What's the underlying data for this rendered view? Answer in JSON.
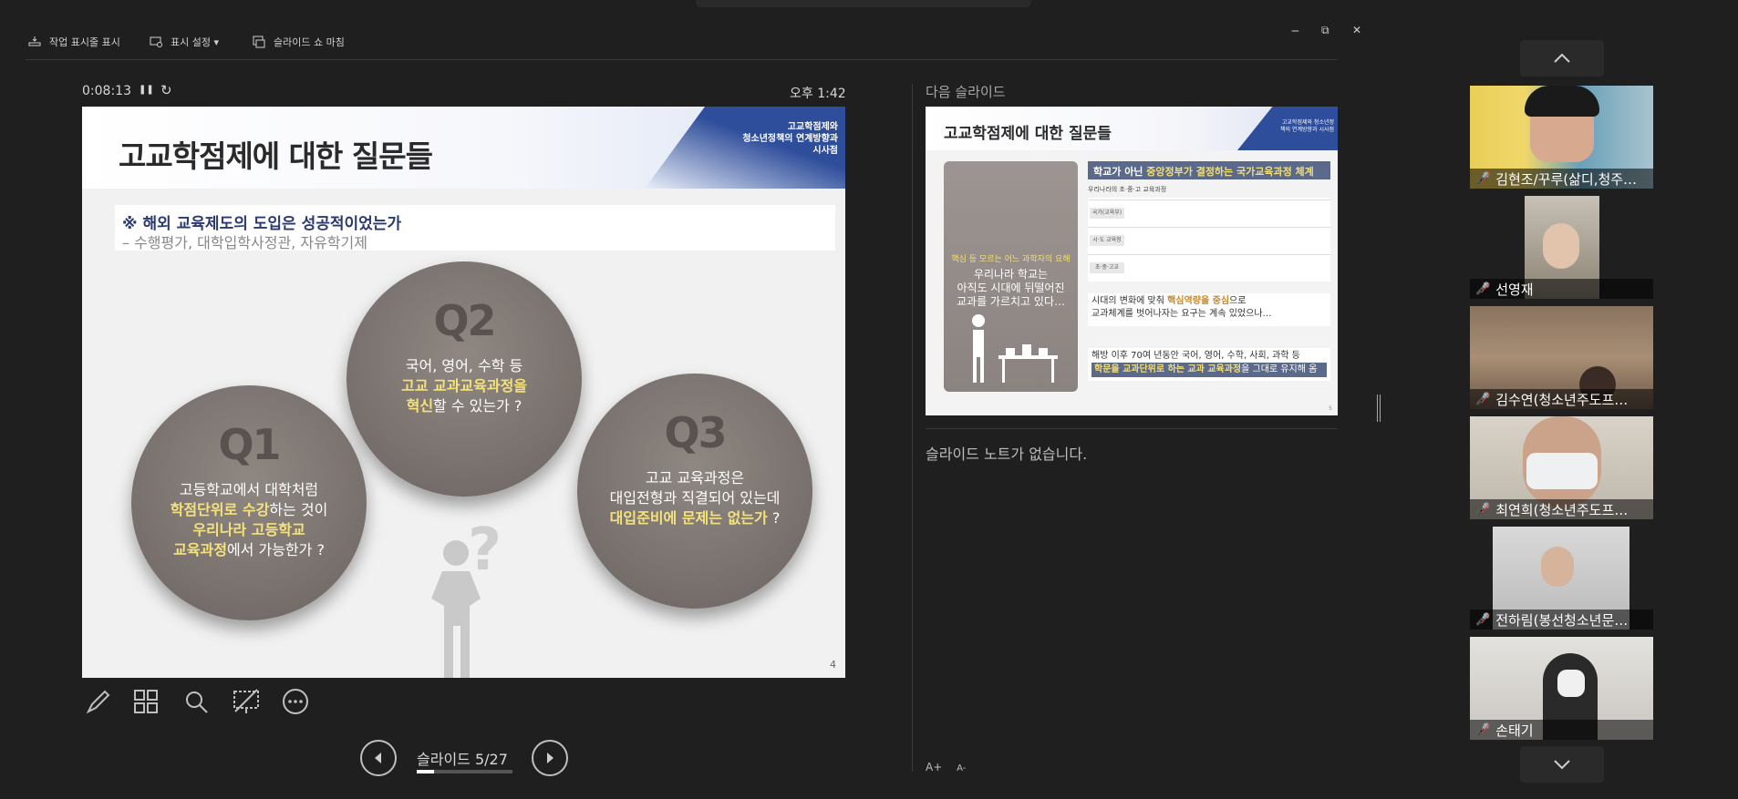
{
  "toolbar": {
    "taskbar_label": "작업 표시줄 표시",
    "display_settings_label": "표시 설정 ▾",
    "end_slideshow_label": "슬라이드 쇼 마침"
  },
  "window": {
    "minimize": "‒",
    "restore": "⧉",
    "close": "✕"
  },
  "presenter": {
    "elapsed": "0:08:13",
    "pause_icon": "❚❚",
    "reset_icon": "↻",
    "clock": "오후 1:42"
  },
  "current_slide": {
    "title": "고교학점제에 대한 질문들",
    "header_sub_1": "고교학점제와",
    "header_sub_2": "청소년정책의 연계방향과",
    "header_sub_3": "시사점",
    "note_line1": "※ 해외 교육제도의 도입은 성공적이었는가",
    "note_line2": "– 수행평가, 대학입학사정관, 자유학기제",
    "q1": {
      "label": "Q1",
      "t1": "고등학교에서 대학처럼",
      "t2a": "학점단위로 수강",
      "t2b": "하는 것이",
      "t3": "우리나라 고등학교",
      "t4a": "교육과정",
      "t4b": "에서 가능한가 ?"
    },
    "q2": {
      "label": "Q2",
      "t1": "국어, 영어, 수학 등",
      "t2": "고교 교과교육과정을",
      "t3a": "혁신",
      "t3b": "할 수 있는가 ?"
    },
    "q3": {
      "label": "Q3",
      "t1": "고교 교육과정은",
      "t2": "대입전형과 직결되어 있는데",
      "t3a": "대입준비에 문제는 없는가",
      "t3b": " ?"
    },
    "page_number": "4"
  },
  "navigation": {
    "counter": "슬라이드 5/27",
    "progress": 0.185
  },
  "next_slide": {
    "heading": "다음 슬라이드",
    "title": "고교학점제에 대한 질문들",
    "header_sub": "고교학점제와 청소년정책의 연계방향과 시사점",
    "left_a": "핵심 등 모르는 어느 과학자의 요해",
    "left_b1": "우리나라 학교는",
    "left_b2": "아직도 시대에 뒤떨어진",
    "left_b3": "교과를 가르치고 있다…",
    "bar1_a": "학교가 아닌 ",
    "bar1_b": "중앙정부가 결정하는 국가교육과정 체계",
    "table_caption": "우리나라의 초·중·고 교육과정",
    "row1_key": "국가(교육부)",
    "row2_key": "시·도 교육청",
    "row3_key": "초·중·고교",
    "mid_a": "시대의 변화에 맞춰 ",
    "mid_b": "핵심역량을 중심",
    "mid_c": "으로",
    "mid_d": "교과체계를 벗어나자는 요구는 계속 있었으나…",
    "low_a": "해방 이후 70여 년동안 국어, 영어, 수학, 사회, 과학 등",
    "low_b": "학문을 교과단위로 하는 교과 교육과정",
    "low_c": "을 그대로 유지해 옴",
    "page_number": "5"
  },
  "notes": {
    "text": "슬라이드 노트가 없습니다."
  },
  "font_controls": {
    "increase": "A+",
    "decrease": "A-"
  },
  "participants": [
    {
      "name": "김현조/꾸루(삶디,청주…",
      "muted": true
    },
    {
      "name": "선영재",
      "muted": true
    },
    {
      "name": "김수연(청소년주도프…",
      "muted": true
    },
    {
      "name": "최연희(청소년주도프…",
      "muted": true
    },
    {
      "name": "전하림(봉선청소년문…",
      "muted": true
    },
    {
      "name": "손태기",
      "muted": true
    }
  ],
  "colors": {
    "accent_blue": "#2e4d9a",
    "highlight_yellow": "#f5e27a",
    "mute_red": "#e53935"
  }
}
